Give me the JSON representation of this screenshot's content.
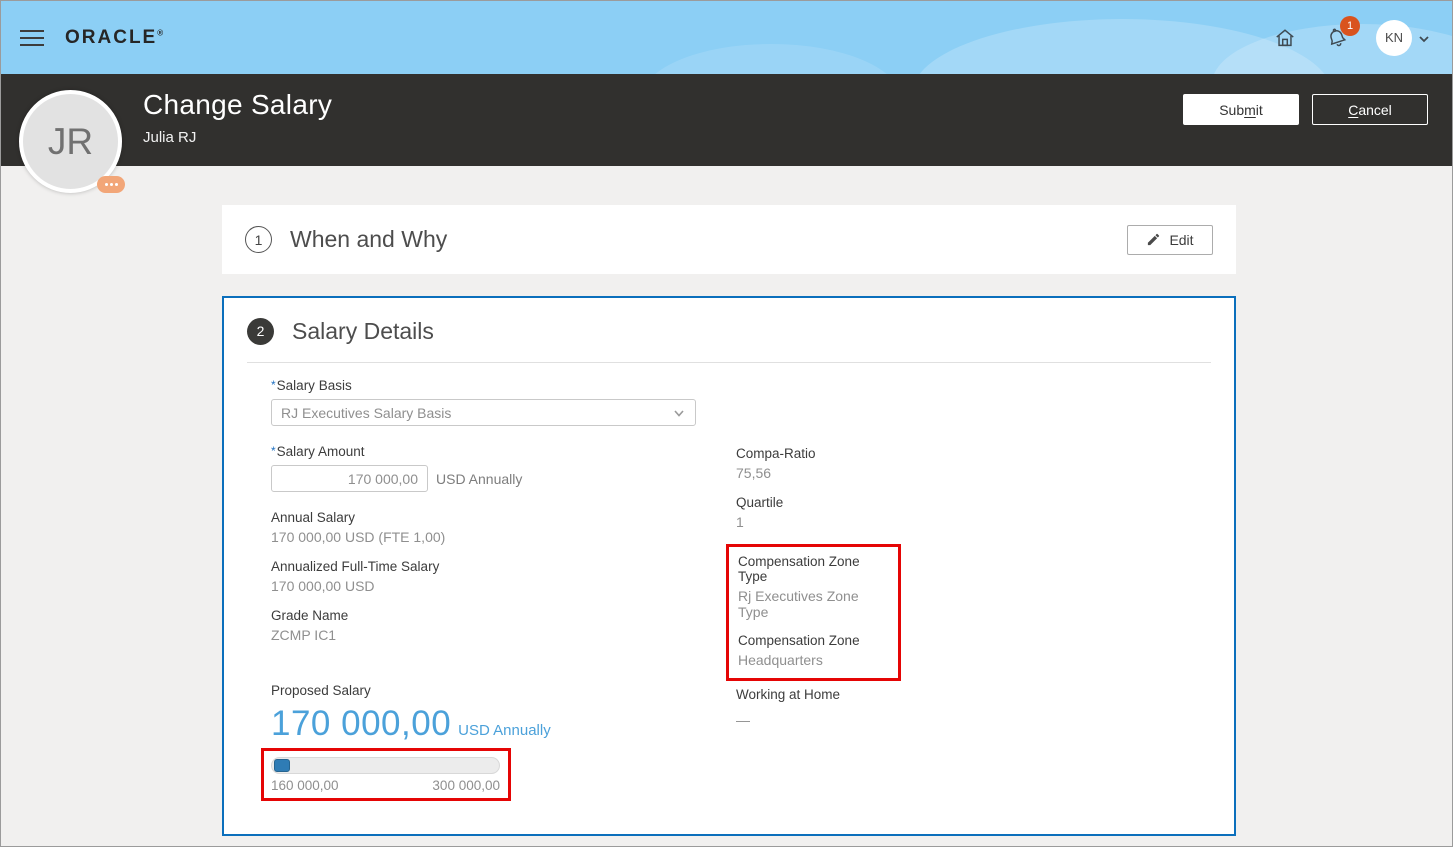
{
  "colors": {
    "topbar_blue": "#8ccff5",
    "header_dark": "#31302e",
    "section_border_blue": "#0b6fbc",
    "annotation_red": "#e50505",
    "proposed_blue": "#4ba1da",
    "badge_orange": "#d9531e"
  },
  "topbar": {
    "brand": "ORACLE",
    "brand_mark": "®",
    "notification_count": "1",
    "user_initials": "KN"
  },
  "header": {
    "title": "Change Salary",
    "subtitle": "Julia RJ",
    "avatar_initials": "JR",
    "submit": {
      "pre": "Sub",
      "key": "m",
      "post": "it"
    },
    "cancel": {
      "pre": "",
      "key": "C",
      "post": "ancel"
    }
  },
  "when_why": {
    "number": "1",
    "title": "When and Why",
    "edit_label": "Edit"
  },
  "salary": {
    "number": "2",
    "title": "Salary Details",
    "salary_basis": {
      "required_marker": "*",
      "label": "Salary Basis",
      "value": "RJ Executives Salary Basis"
    },
    "salary_amount": {
      "required_marker": "*",
      "label": "Salary Amount",
      "value": "170 000,00",
      "suffix": "USD Annually"
    },
    "readonly_left": [
      {
        "label": "Annual Salary",
        "value": "170 000,00 USD (FTE 1,00)"
      },
      {
        "label": "Annualized Full-Time Salary",
        "value": "170 000,00 USD"
      },
      {
        "label": "Grade Name",
        "value": "ZCMP IC1"
      }
    ],
    "readonly_right": [
      {
        "label": "Compa-Ratio",
        "value": "75,56"
      },
      {
        "label": "Quartile",
        "value": "1"
      }
    ],
    "zone_fields": [
      {
        "label": "Compensation Zone Type",
        "value": "Rj Executives Zone Type"
      },
      {
        "label": "Compensation Zone",
        "value": "Headquarters"
      }
    ],
    "working_at_home": {
      "label": "Working at Home",
      "value": "—"
    },
    "proposed": {
      "label": "Proposed Salary",
      "value": "170 000,00",
      "suffix": "USD Annually",
      "slider": {
        "min_label": "160 000,00",
        "max_label": "300 000,00",
        "min": 160000,
        "max": 300000,
        "value": 170000
      }
    }
  }
}
